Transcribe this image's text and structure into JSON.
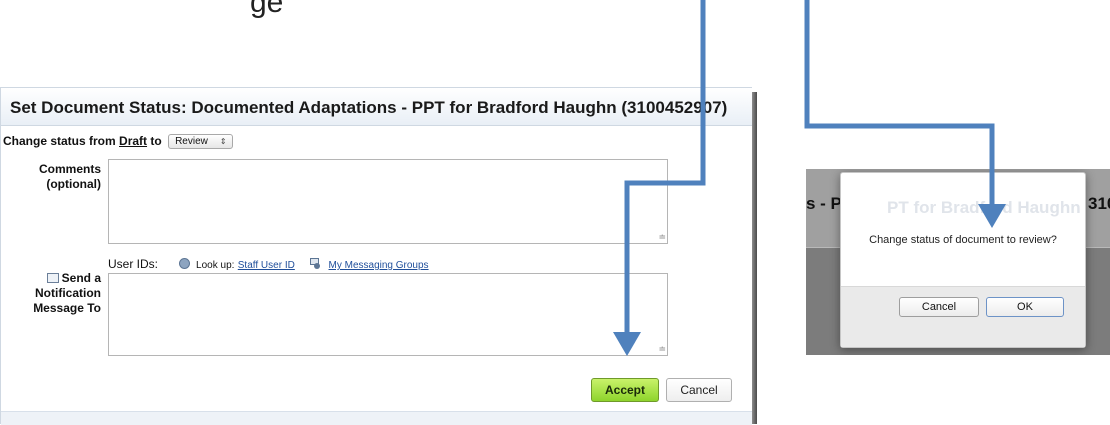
{
  "caption": "ge",
  "dialog": {
    "title": "Set Document Status: Documented Adaptations - PPT for Bradford Haughn (3100452907)",
    "status_prefix": "Change status from",
    "status_from": "Draft",
    "status_to_word": "to",
    "status_to_selected": "Review",
    "comments_label_line1": "Comments",
    "comments_label_line2": "(optional)",
    "user_ids_label": "User IDs:",
    "lookup_label": "Look up:",
    "staff_user_id_link": "Staff User ID",
    "messaging_groups_link": "My Messaging Groups",
    "notify_label_line1": "Send a",
    "notify_label_line2": "Notification",
    "notify_label_line3": "Message To",
    "accept_label": "Accept",
    "cancel_label": "Cancel"
  },
  "confirm": {
    "bg_title_left": "s - P",
    "bg_title_behind": "PT for Bradford Haughn",
    "bg_title_right": "310",
    "message": "Change status of document to review?",
    "cancel_label": "Cancel",
    "ok_label": "OK"
  },
  "colors": {
    "arrow": "#4f81bd",
    "accept_green": "#8ed42c",
    "link_blue": "#1f4e9a"
  }
}
